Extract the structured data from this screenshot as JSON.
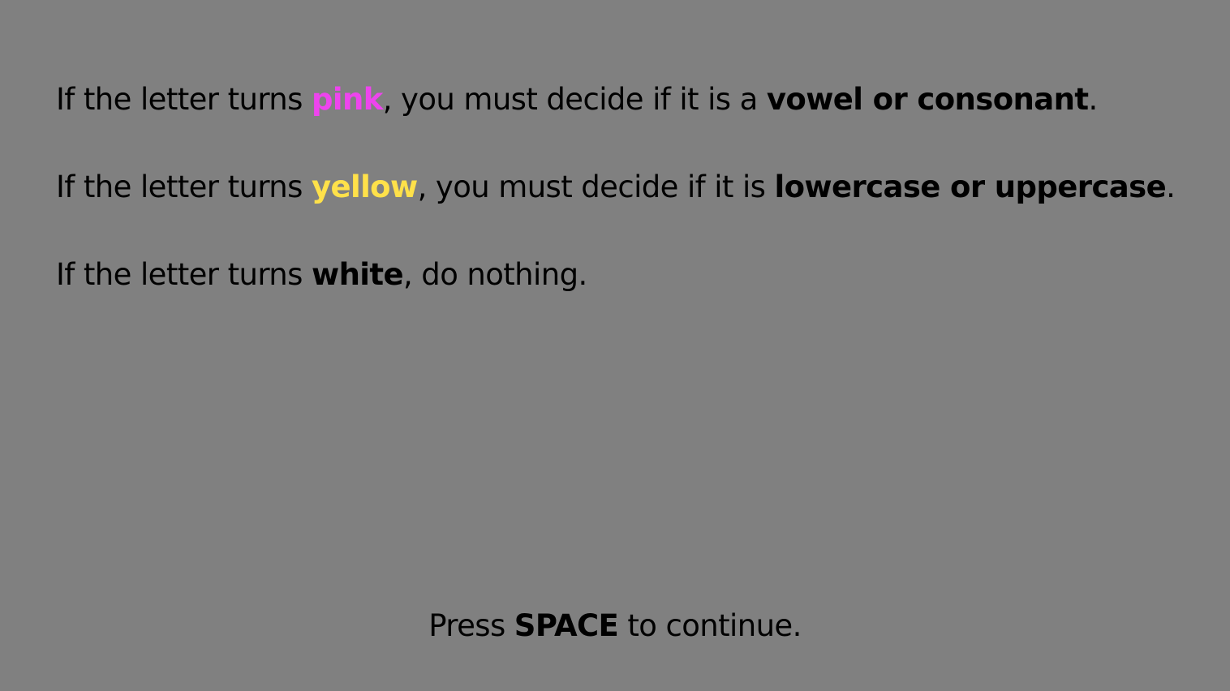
{
  "instructions": [
    {
      "prefix": "If the letter turns ",
      "color_word": "pink",
      "color_hex": "#ee44ee",
      "middle": ", you must decide if it is a ",
      "task": "vowel or consonant",
      "suffix": "."
    },
    {
      "prefix": "If the letter turns ",
      "color_word": "yellow",
      "color_hex": "#ffe14a",
      "middle": ", you must decide if it is ",
      "task": "lowercase or uppercase",
      "suffix": "."
    },
    {
      "prefix": "If the letter turns ",
      "color_word": "white",
      "color_hex": "#000000",
      "middle": ", do nothing.",
      "task": "",
      "suffix": ""
    }
  ],
  "footer": {
    "prefix": "Press ",
    "key": "SPACE",
    "suffix": " to continue."
  },
  "colors": {
    "background": "#808080",
    "text": "#000000"
  }
}
